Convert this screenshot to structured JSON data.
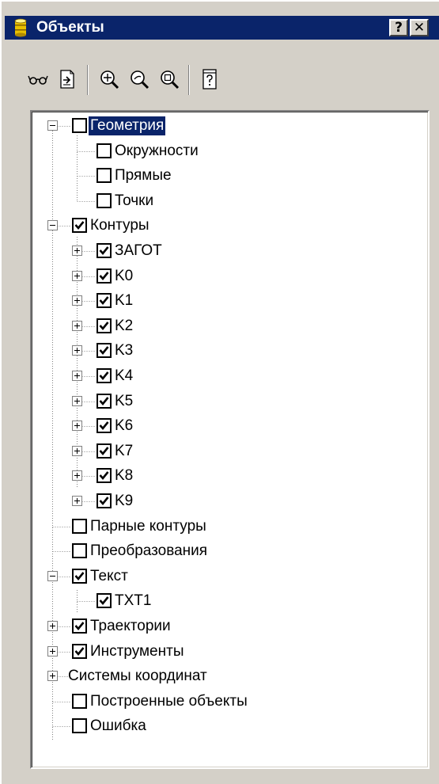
{
  "window": {
    "title": "Объекты",
    "help_button": "?",
    "close_button": "✕"
  },
  "toolbar": {
    "buttons": [
      {
        "name": "glasses-icon"
      },
      {
        "name": "export-document-icon"
      },
      {
        "name": "zoom-in-icon"
      },
      {
        "name": "zoom-out-icon"
      },
      {
        "name": "zoom-fit-icon"
      },
      {
        "name": "help-document-icon"
      }
    ]
  },
  "tree": {
    "items": [
      {
        "label": "Геометрия",
        "level": 0,
        "expander": "minus",
        "checkbox": "unchecked",
        "selected": true
      },
      {
        "label": "Окружности",
        "level": 1,
        "expander": "none",
        "checkbox": "unchecked"
      },
      {
        "label": "Прямые",
        "level": 1,
        "expander": "none",
        "checkbox": "unchecked"
      },
      {
        "label": "Точки",
        "level": 1,
        "expander": "none",
        "checkbox": "unchecked"
      },
      {
        "label": "Контуры",
        "level": 0,
        "expander": "minus",
        "checkbox": "checked"
      },
      {
        "label": "ЗАГОТ",
        "level": 1,
        "expander": "plus",
        "checkbox": "checked"
      },
      {
        "label": "K0",
        "level": 1,
        "expander": "plus",
        "checkbox": "checked"
      },
      {
        "label": "K1",
        "level": 1,
        "expander": "plus",
        "checkbox": "checked"
      },
      {
        "label": "K2",
        "level": 1,
        "expander": "plus",
        "checkbox": "checked"
      },
      {
        "label": "K3",
        "level": 1,
        "expander": "plus",
        "checkbox": "checked"
      },
      {
        "label": "K4",
        "level": 1,
        "expander": "plus",
        "checkbox": "checked"
      },
      {
        "label": "K5",
        "level": 1,
        "expander": "plus",
        "checkbox": "checked"
      },
      {
        "label": "K6",
        "level": 1,
        "expander": "plus",
        "checkbox": "checked"
      },
      {
        "label": "K7",
        "level": 1,
        "expander": "plus",
        "checkbox": "checked"
      },
      {
        "label": "K8",
        "level": 1,
        "expander": "plus",
        "checkbox": "checked"
      },
      {
        "label": "K9",
        "level": 1,
        "expander": "plus",
        "checkbox": "checked"
      },
      {
        "label": "Парные контуры",
        "level": 0,
        "expander": "none",
        "checkbox": "unchecked"
      },
      {
        "label": "Преобразования",
        "level": 0,
        "expander": "none",
        "checkbox": "unchecked"
      },
      {
        "label": "Текст",
        "level": 0,
        "expander": "minus",
        "checkbox": "checked"
      },
      {
        "label": "TXT1",
        "level": 1,
        "expander": "none",
        "checkbox": "checked"
      },
      {
        "label": "Траектории",
        "level": 0,
        "expander": "plus",
        "checkbox": "checked"
      },
      {
        "label": "Инструменты",
        "level": 0,
        "expander": "plus",
        "checkbox": "checked"
      },
      {
        "label": "Системы координат",
        "level": 0,
        "expander": "plus",
        "checkbox": "none"
      },
      {
        "label": "Построенные объекты",
        "level": 0,
        "expander": "none",
        "checkbox": "unchecked"
      },
      {
        "label": "Ошибка",
        "level": 0,
        "expander": "none",
        "checkbox": "unchecked"
      }
    ]
  },
  "colors": {
    "titlebar": "#0a246a",
    "window_face": "#d4d0c8",
    "selection": "#0a246a"
  }
}
